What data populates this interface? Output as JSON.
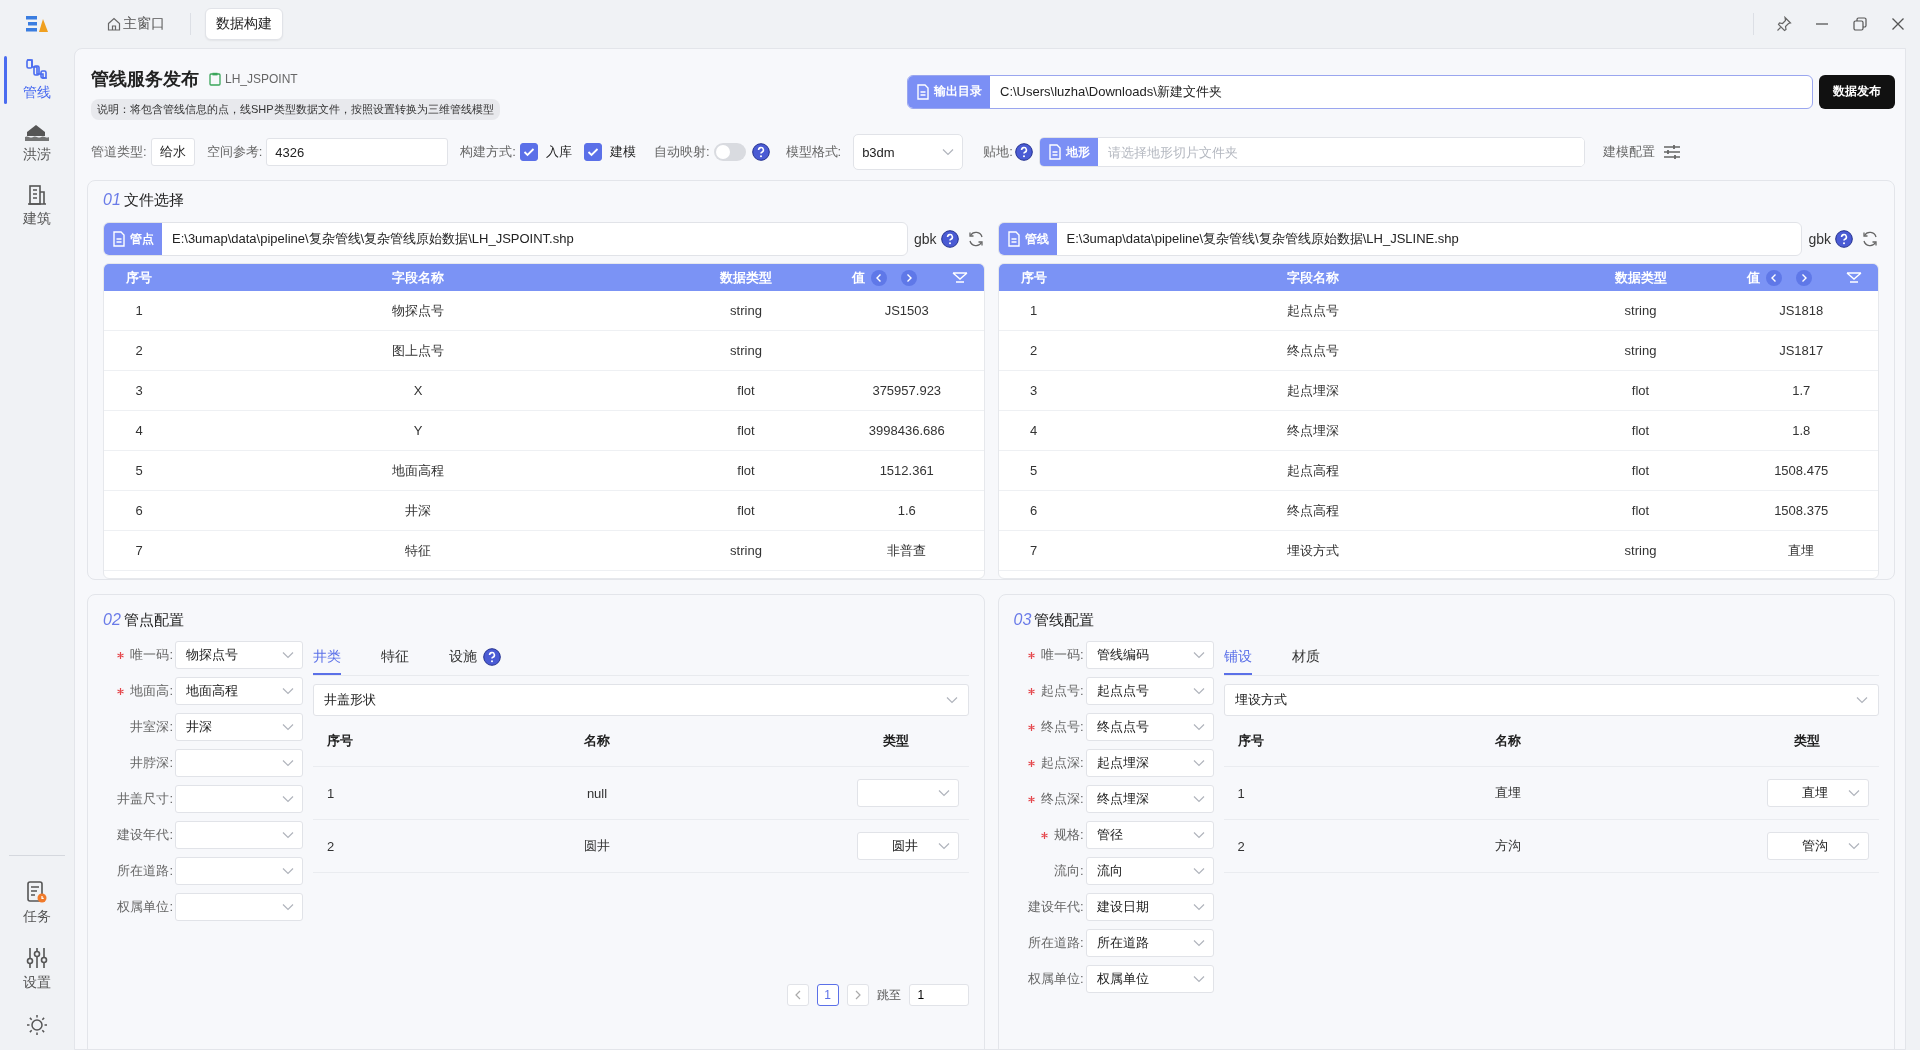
{
  "top_tabs": [
    {
      "label": "主窗口",
      "selected": false
    },
    {
      "label": "数据构建",
      "selected": true
    }
  ],
  "sidebar": {
    "items": [
      {
        "label": "管线",
        "kind": "pipes",
        "selected": true
      },
      {
        "label": "洪涝",
        "kind": "flood",
        "selected": false
      },
      {
        "label": "建筑",
        "kind": "building",
        "selected": false
      }
    ],
    "bottom_items": [
      {
        "label": "任务",
        "kind": "task"
      },
      {
        "label": "设置",
        "kind": "settings"
      }
    ]
  },
  "header": {
    "title": "管线服务发布",
    "layer": "LH_JSPOINT",
    "description": "说明：将包含管线信息的点，线SHP类型数据文件，按照设置转换为三维管线模型",
    "output": {
      "tag": "输出目录",
      "value": "C:\\Users\\luzha\\Downloads\\新建文件夹"
    },
    "publish_button": "数据发布"
  },
  "options": {
    "pipe_type": {
      "label": "管道类型:",
      "value": "给水"
    },
    "spatial_ref": {
      "label": "空间参考:",
      "value": "4326"
    },
    "build_mode": {
      "label": "构建方式:",
      "options": [
        {
          "label": "入库",
          "checked": true
        },
        {
          "label": "建模",
          "checked": true
        }
      ]
    },
    "auto_map": {
      "label": "自动映射:",
      "on": false
    },
    "model_format": {
      "label": "模型格式:",
      "value": "b3dm"
    },
    "terrain": {
      "label": "贴地:",
      "tag": "地形",
      "placeholder": "请选择地形切片文件夹"
    },
    "model_config": "建模配置"
  },
  "file_section": {
    "number": "01",
    "title": "文件选择",
    "panels": [
      {
        "tag": "管点",
        "path": "E:\\3umap\\data\\pipeline\\复杂管线\\复杂管线原始数据\\LH_JSPOINT.shp",
        "encoding": "gbk",
        "columns": [
          "序号",
          "字段名称",
          "数据类型",
          "值"
        ],
        "rows": [
          {
            "index": "1",
            "field": "物探点号",
            "type": "string",
            "value": "JS1503"
          },
          {
            "index": "2",
            "field": "图上点号",
            "type": "string"
          },
          {
            "index": "3",
            "field": "X",
            "type": "flot",
            "value": "375957.923"
          },
          {
            "index": "4",
            "field": "Y",
            "type": "flot",
            "value": "3998436.686"
          },
          {
            "index": "5",
            "field": "地面高程",
            "type": "flot",
            "value": "1512.361"
          },
          {
            "index": "6",
            "field": "井深",
            "type": "flot",
            "value": "1.6"
          },
          {
            "index": "7",
            "field": "特征",
            "type": "string",
            "value": "非普查"
          }
        ]
      },
      {
        "tag": "管线",
        "path": "E:\\3umap\\data\\pipeline\\复杂管线\\复杂管线原始数据\\LH_JSLINE.shp",
        "encoding": "gbk",
        "columns": [
          "序号",
          "字段名称",
          "数据类型",
          "值"
        ],
        "rows": [
          {
            "index": "1",
            "field": "起点点号",
            "type": "string",
            "value": "JS1818"
          },
          {
            "index": "2",
            "field": "终点点号",
            "type": "string",
            "value": "JS1817"
          },
          {
            "index": "3",
            "field": "起点埋深",
            "type": "flot",
            "value": "1.7"
          },
          {
            "index": "4",
            "field": "终点埋深",
            "type": "flot",
            "value": "1.8"
          },
          {
            "index": "5",
            "field": "起点高程",
            "type": "flot",
            "value": "1508.475"
          },
          {
            "index": "6",
            "field": "终点高程",
            "type": "flot",
            "value": "1508.375"
          },
          {
            "index": "7",
            "field": "埋设方式",
            "type": "string",
            "value": "直埋"
          }
        ]
      }
    ]
  },
  "config_sections": [
    {
      "number": "02",
      "title": "管点配置",
      "fields": [
        {
          "label": "唯一码:",
          "required": true,
          "value": "物探点号"
        },
        {
          "label": "地面高:",
          "required": true,
          "value": "地面高程"
        },
        {
          "label": "井室深:",
          "required": false,
          "value": "井深"
        },
        {
          "label": "井脖深:",
          "required": false
        },
        {
          "label": "井盖尺寸:",
          "required": false
        },
        {
          "label": "建设年代:",
          "required": false
        },
        {
          "label": "所在道路:",
          "required": false
        },
        {
          "label": "权属单位:",
          "required": false
        }
      ],
      "tabs": [
        {
          "label": "井类",
          "selected": true,
          "help": false
        },
        {
          "label": "特征",
          "selected": false,
          "help": false
        },
        {
          "label": "设施",
          "selected": false,
          "help": true
        }
      ],
      "dropdown": "井盖形状",
      "columns": [
        "序号",
        "名称",
        "类型"
      ],
      "rows": [
        {
          "index": "1",
          "name": "null"
        },
        {
          "index": "2",
          "name": "圆井",
          "type": "圆井"
        }
      ],
      "pagination": {
        "page": "1",
        "jump_label": "跳至",
        "jump_value": "1"
      }
    },
    {
      "number": "03",
      "title": "管线配置",
      "fields": [
        {
          "label": "唯一码:",
          "required": true,
          "value": "管线编码"
        },
        {
          "label": "起点号:",
          "required": true,
          "value": "起点点号"
        },
        {
          "label": "终点号:",
          "required": true,
          "value": "终点点号"
        },
        {
          "label": "起点深:",
          "required": true,
          "value": "起点埋深"
        },
        {
          "label": "终点深:",
          "required": true,
          "value": "终点埋深"
        },
        {
          "label": "规格:",
          "required": true,
          "value": "管径"
        },
        {
          "label": "流向:",
          "required": false,
          "value": "流向"
        },
        {
          "label": "建设年代:",
          "required": false,
          "value": "建设日期"
        },
        {
          "label": "所在道路:",
          "required": false,
          "value": "所在道路"
        },
        {
          "label": "权属单位:",
          "required": false,
          "value": "权属单位"
        }
      ],
      "tabs": [
        {
          "label": "铺设",
          "selected": true,
          "help": false
        },
        {
          "label": "材质",
          "selected": false,
          "help": false
        }
      ],
      "dropdown": "埋设方式",
      "columns": [
        "序号",
        "名称",
        "类型"
      ],
      "rows": [
        {
          "index": "1",
          "name": "直埋",
          "type": "直埋"
        },
        {
          "index": "2",
          "name": "方沟",
          "type": "管沟"
        }
      ]
    }
  ]
}
